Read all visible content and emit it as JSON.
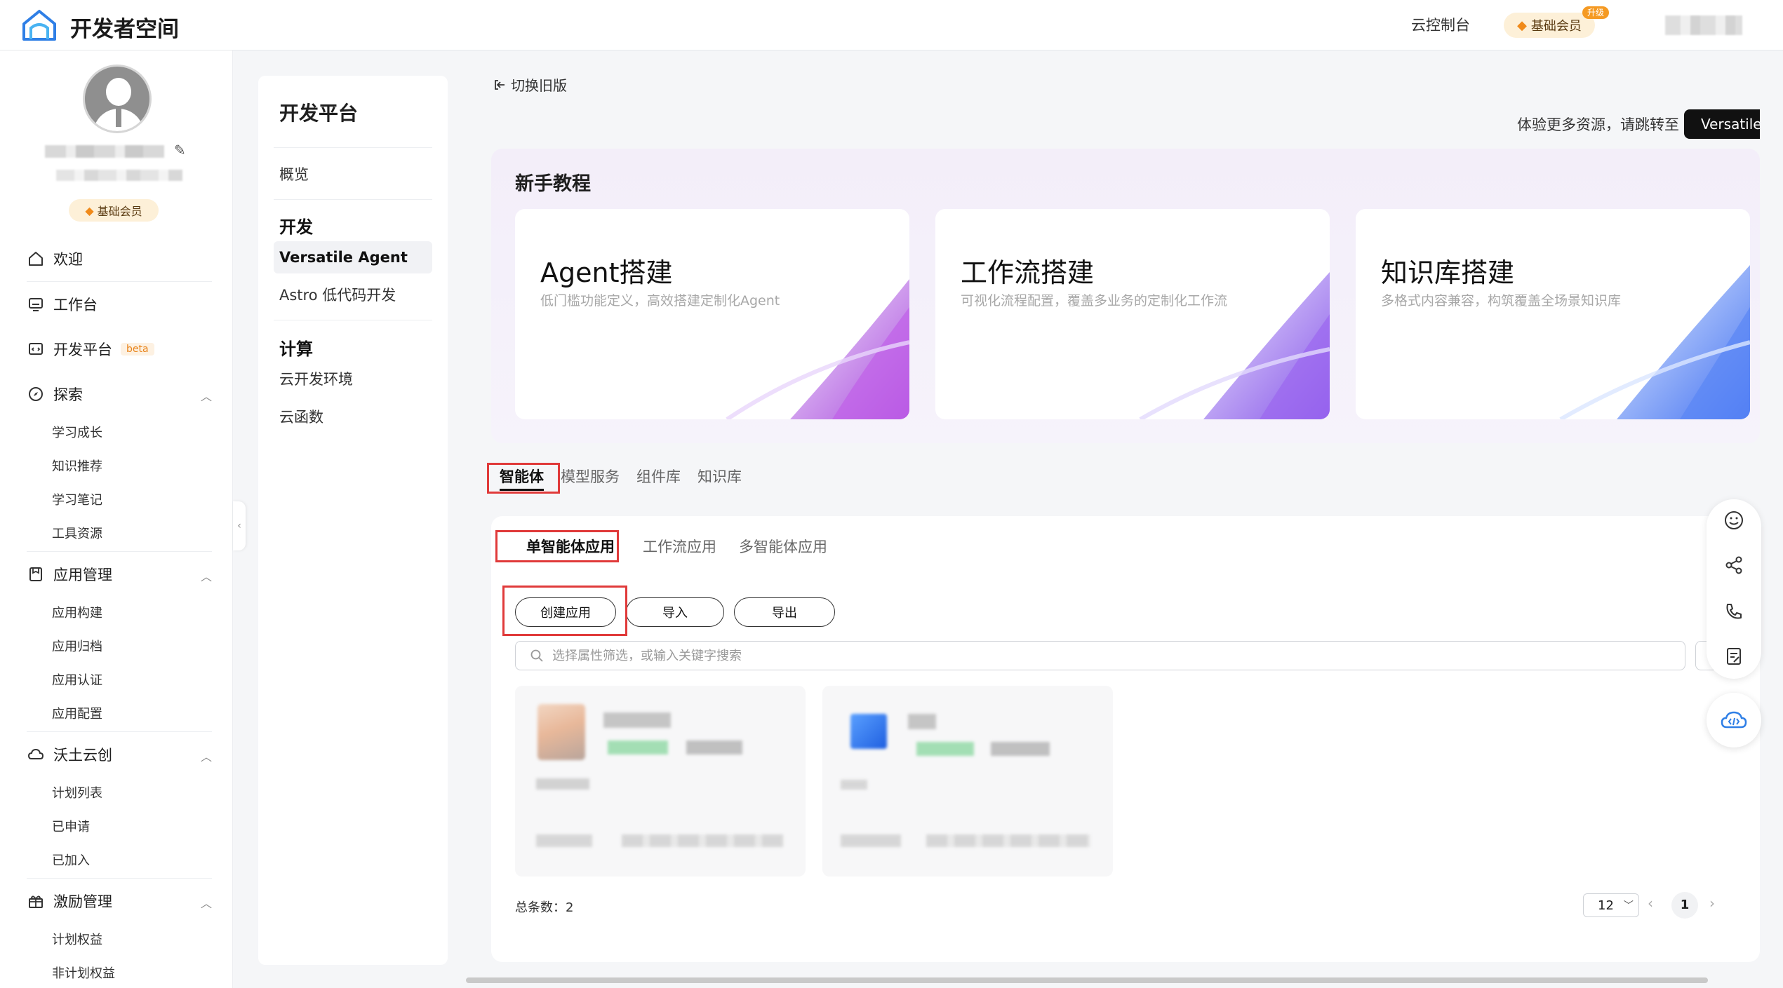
{
  "header": {
    "app_title": "开发者空间",
    "console_link": "云控制台",
    "member_label": "基础会员",
    "upgrade_tag": "升级"
  },
  "sidebar": {
    "member_badge": "基础会员",
    "items": [
      {
        "label": "欢迎",
        "icon": "home-icon"
      },
      {
        "label": "工作台",
        "icon": "monitor-icon"
      },
      {
        "label": "开发平台",
        "icon": "code-window-icon",
        "badge": "beta"
      },
      {
        "label": "探索",
        "icon": "compass-icon",
        "children": [
          "学习成长",
          "知识推荐",
          "学习笔记",
          "工具资源"
        ]
      },
      {
        "label": "应用管理",
        "icon": "app-box-icon",
        "children": [
          "应用构建",
          "应用归档",
          "应用认证",
          "应用配置"
        ]
      },
      {
        "label": "沃土云创",
        "icon": "cloud-icon",
        "children": [
          "计划列表",
          "已申请",
          "已加入"
        ]
      },
      {
        "label": "激励管理",
        "icon": "gift-icon",
        "children": [
          "计划权益",
          "非计划权益"
        ]
      }
    ]
  },
  "devmenu": {
    "title": "开发平台",
    "overview": "概览",
    "group_dev": "开发",
    "item_versatile": "Versatile Agent",
    "item_astro": "Astro 低代码开发",
    "group_compute": "计算",
    "item_cloud_env": "云开发环境",
    "item_functions": "云函数"
  },
  "main": {
    "switch_old": "切换旧版",
    "promo_text": "体验更多资源，请跳转至",
    "promo_button": "Versatile",
    "tutorial_title": "新手教程",
    "tutorial_cards": [
      {
        "title": "Agent搭建",
        "subtitle": "低门槛功能定义，高效搭建定制化Agent"
      },
      {
        "title": "工作流搭建",
        "subtitle": "可视化流程配置，覆盖多业务的定制化工作流"
      },
      {
        "title": "知识库搭建",
        "subtitle": "多格式内容兼容，构筑覆盖全场景知识库"
      }
    ],
    "tabs": [
      "智能体",
      "模型服务",
      "组件库",
      "知识库"
    ],
    "sub_tabs": [
      "单智能体应用",
      "工作流应用",
      "多智能体应用"
    ],
    "buttons": {
      "create": "创建应用",
      "import": "导入",
      "export": "导出"
    },
    "search_placeholder": "选择属性筛选，或输入关键字搜索",
    "total_label": "总条数：",
    "total_count": "2",
    "page_size": "12",
    "current_page": "1"
  },
  "colors": {
    "highlight": "#e03a3a",
    "member_bg": "#fdf0d8",
    "member_accent": "#f08a1a",
    "beta": "#e8841b"
  }
}
